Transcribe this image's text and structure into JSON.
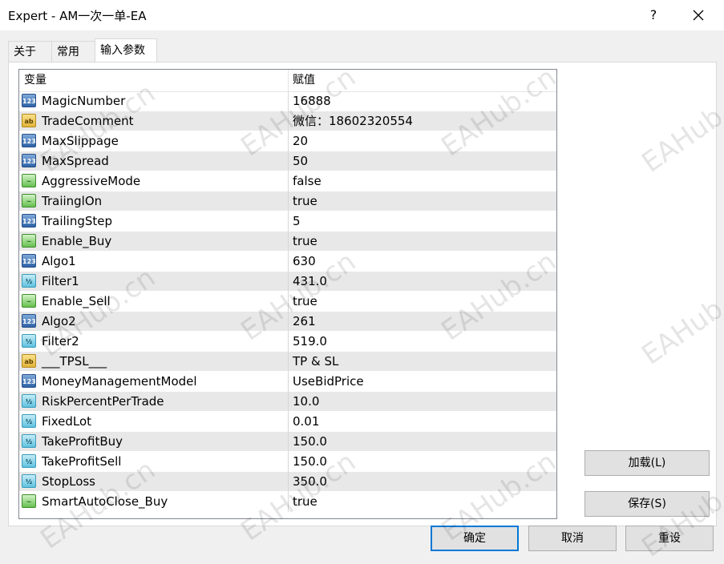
{
  "window": {
    "title": "Expert - AM一次一单-EA",
    "help_label": "?",
    "tabs": [
      {
        "label": "关于"
      },
      {
        "label": "常用"
      },
      {
        "label": "输入参数"
      }
    ]
  },
  "grid": {
    "col_variable": "变量",
    "col_value": "赋值",
    "rows": [
      {
        "type": "int",
        "icon": "123",
        "name": "MagicNumber",
        "value": "16888"
      },
      {
        "type": "str",
        "icon": "ab",
        "name": "TradeComment",
        "value": "微信：18602320554"
      },
      {
        "type": "int",
        "icon": "123",
        "name": "MaxSlippage",
        "value": "20"
      },
      {
        "type": "int",
        "icon": "123",
        "name": "MaxSpread",
        "value": "50"
      },
      {
        "type": "bool",
        "icon": "~",
        "name": "AggressiveMode",
        "value": "false"
      },
      {
        "type": "bool",
        "icon": "~",
        "name": "TraiinglOn",
        "value": "true"
      },
      {
        "type": "int",
        "icon": "123",
        "name": "TrailingStep",
        "value": "5"
      },
      {
        "type": "bool",
        "icon": "~",
        "name": "Enable_Buy",
        "value": "true"
      },
      {
        "type": "int",
        "icon": "123",
        "name": "Algo1",
        "value": "630"
      },
      {
        "type": "dbl",
        "icon": "½",
        "name": "Filter1",
        "value": "431.0"
      },
      {
        "type": "bool",
        "icon": "~",
        "name": "Enable_Sell",
        "value": "true"
      },
      {
        "type": "int",
        "icon": "123",
        "name": "Algo2",
        "value": "261"
      },
      {
        "type": "dbl",
        "icon": "½",
        "name": "Filter2",
        "value": "519.0"
      },
      {
        "type": "str",
        "icon": "ab",
        "name": "___TPSL___",
        "value": "TP & SL"
      },
      {
        "type": "int",
        "icon": "123",
        "name": "MoneyManagementModel",
        "value": "UseBidPrice"
      },
      {
        "type": "dbl",
        "icon": "½",
        "name": "RiskPercentPerTrade",
        "value": "10.0"
      },
      {
        "type": "dbl",
        "icon": "½",
        "name": "FixedLot",
        "value": "0.01"
      },
      {
        "type": "dbl",
        "icon": "½",
        "name": "TakeProfitBuy",
        "value": "150.0"
      },
      {
        "type": "dbl",
        "icon": "½",
        "name": "TakeProfitSell",
        "value": "150.0"
      },
      {
        "type": "dbl",
        "icon": "½",
        "name": "StopLoss",
        "value": "350.0"
      },
      {
        "type": "bool",
        "icon": "~",
        "name": "SmartAutoClose_Buy",
        "value": "true"
      }
    ]
  },
  "buttons": {
    "load": "加载(L)",
    "save": "保存(S)",
    "ok": "确定",
    "cancel": "取消",
    "reset": "重设"
  },
  "watermark": "EAHub.cn"
}
